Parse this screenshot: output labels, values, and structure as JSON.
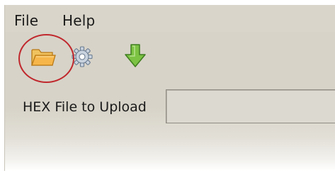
{
  "menubar": {
    "file_label": "File",
    "help_label": "Help"
  },
  "toolbar": {
    "buttons": [
      {
        "name": "open-folder",
        "icon": "folder-open-icon"
      },
      {
        "name": "settings",
        "icon": "gear-icon"
      },
      {
        "name": "upload",
        "icon": "arrow-down-icon"
      }
    ]
  },
  "form": {
    "hex_label": "HEX File to Upload",
    "hex_value": ""
  },
  "colors": {
    "window_bg": "#d7d3c8",
    "highlight": "#c0282d",
    "folder": "#e8a63c",
    "arrow": "#6cb33e",
    "gear": "#b8c6d6"
  }
}
